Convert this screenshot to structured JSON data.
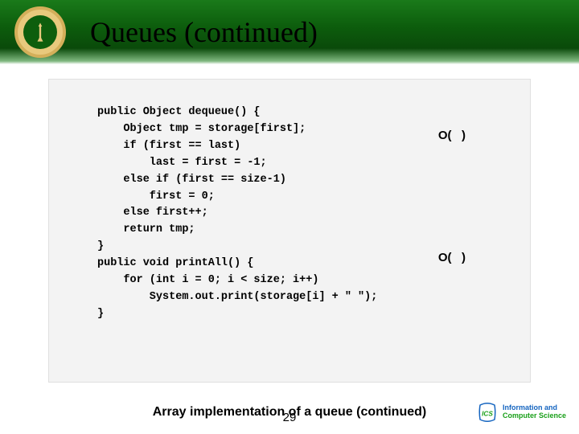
{
  "header": {
    "title": "Queues (continued)"
  },
  "code": {
    "lines": [
      "public Object dequeue() {",
      "    Object tmp = storage[first];",
      "    if (first == last)",
      "        last = first = -1;",
      "    else if (first == size-1)",
      "        first = 0;",
      "    else first++;",
      "    return tmp;",
      "}",
      "public void printAll() {",
      "    for (int i = 0; i < size; i++)",
      "        System.out.print(storage[i] + \" \");",
      "}"
    ],
    "annotations": {
      "a1": "O(   )",
      "a2": "O(   )"
    }
  },
  "caption": "Array implementation of a queue (continued)",
  "page_number": "29",
  "footer": {
    "line1": "Information and",
    "line2": "Computer Science"
  }
}
